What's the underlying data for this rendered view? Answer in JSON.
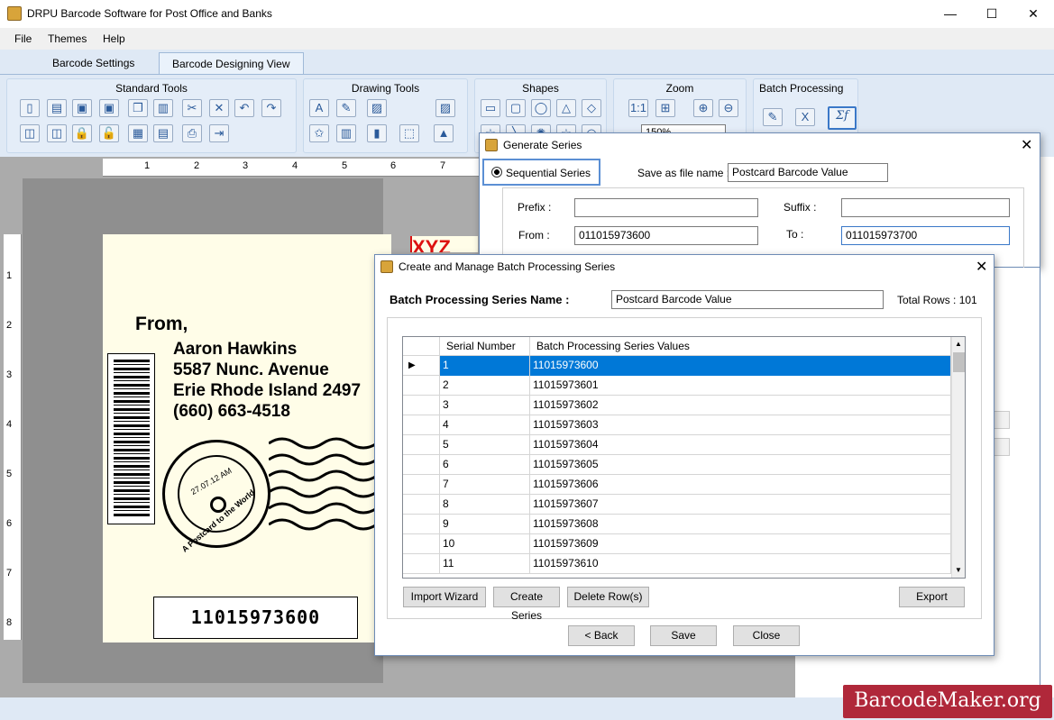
{
  "window": {
    "title": "DRPU Barcode Software for Post Office and Banks",
    "minimize": "—",
    "maximize": "☐",
    "close": "✕"
  },
  "menu": [
    "File",
    "Themes",
    "Help"
  ],
  "tabs": [
    "Barcode Settings",
    "Barcode Designing View"
  ],
  "ribbon": {
    "groups": [
      "Standard Tools",
      "Drawing Tools",
      "Shapes",
      "Zoom",
      "Batch Processing"
    ],
    "zoom_value": "150%"
  },
  "ruler": {
    "h": [
      "1",
      "2",
      "3",
      "4",
      "5",
      "6",
      "7"
    ],
    "v": [
      "1",
      "2",
      "3",
      "4",
      "5",
      "6",
      "7",
      "8"
    ]
  },
  "label": {
    "from": "From,",
    "name": "Aaron Hawkins",
    "street": "5587 Nunc. Avenue",
    "city": "Erie Rhode Island 2497",
    "phone": "(660) 663-4518",
    "barcode_text": "11015973600",
    "stamp_date": "27.07.12 AM",
    "stamp_text": "A Postcard to the World",
    "top_right_text": "XYZ"
  },
  "generate_series": {
    "title": "Generate Series",
    "sequential_label": "Sequential Series",
    "save_as_label": "Save as file name :",
    "save_as_value": "Postcard Barcode  Value",
    "prefix_label": "Prefix :",
    "prefix_value": "",
    "suffix_label": "Suffix :",
    "suffix_value": "",
    "from_label": "From :",
    "from_value": "011015973600",
    "to_label": "To :",
    "to_value": "011015973700"
  },
  "batch_dialog": {
    "title": "Create and Manage Batch Processing Series",
    "name_label": "Batch Processing Series Name :",
    "name_value": "Postcard Barcode  Value",
    "total_rows": "Total Rows : 101",
    "columns": [
      "Serial Number",
      "Batch Processing Series Values"
    ],
    "rows": [
      [
        "1",
        "11015973600"
      ],
      [
        "2",
        "11015973601"
      ],
      [
        "3",
        "11015973602"
      ],
      [
        "4",
        "11015973603"
      ],
      [
        "5",
        "11015973604"
      ],
      [
        "6",
        "11015973605"
      ],
      [
        "7",
        "11015973606"
      ],
      [
        "8",
        "11015973607"
      ],
      [
        "9",
        "11015973608"
      ],
      [
        "10",
        "11015973609"
      ],
      [
        "11",
        "11015973610"
      ]
    ],
    "buttons": {
      "import": "Import Wizard",
      "create": "Create Series",
      "delete": "Delete Row(s)",
      "export": "Export",
      "back": "< Back",
      "save": "Save",
      "close": "Close"
    }
  },
  "watermark": "BarcodeMaker.org",
  "colors": {
    "ribbon": "#dfe9f5",
    "selection": "#0078d7",
    "watermark": "#b0283a"
  }
}
